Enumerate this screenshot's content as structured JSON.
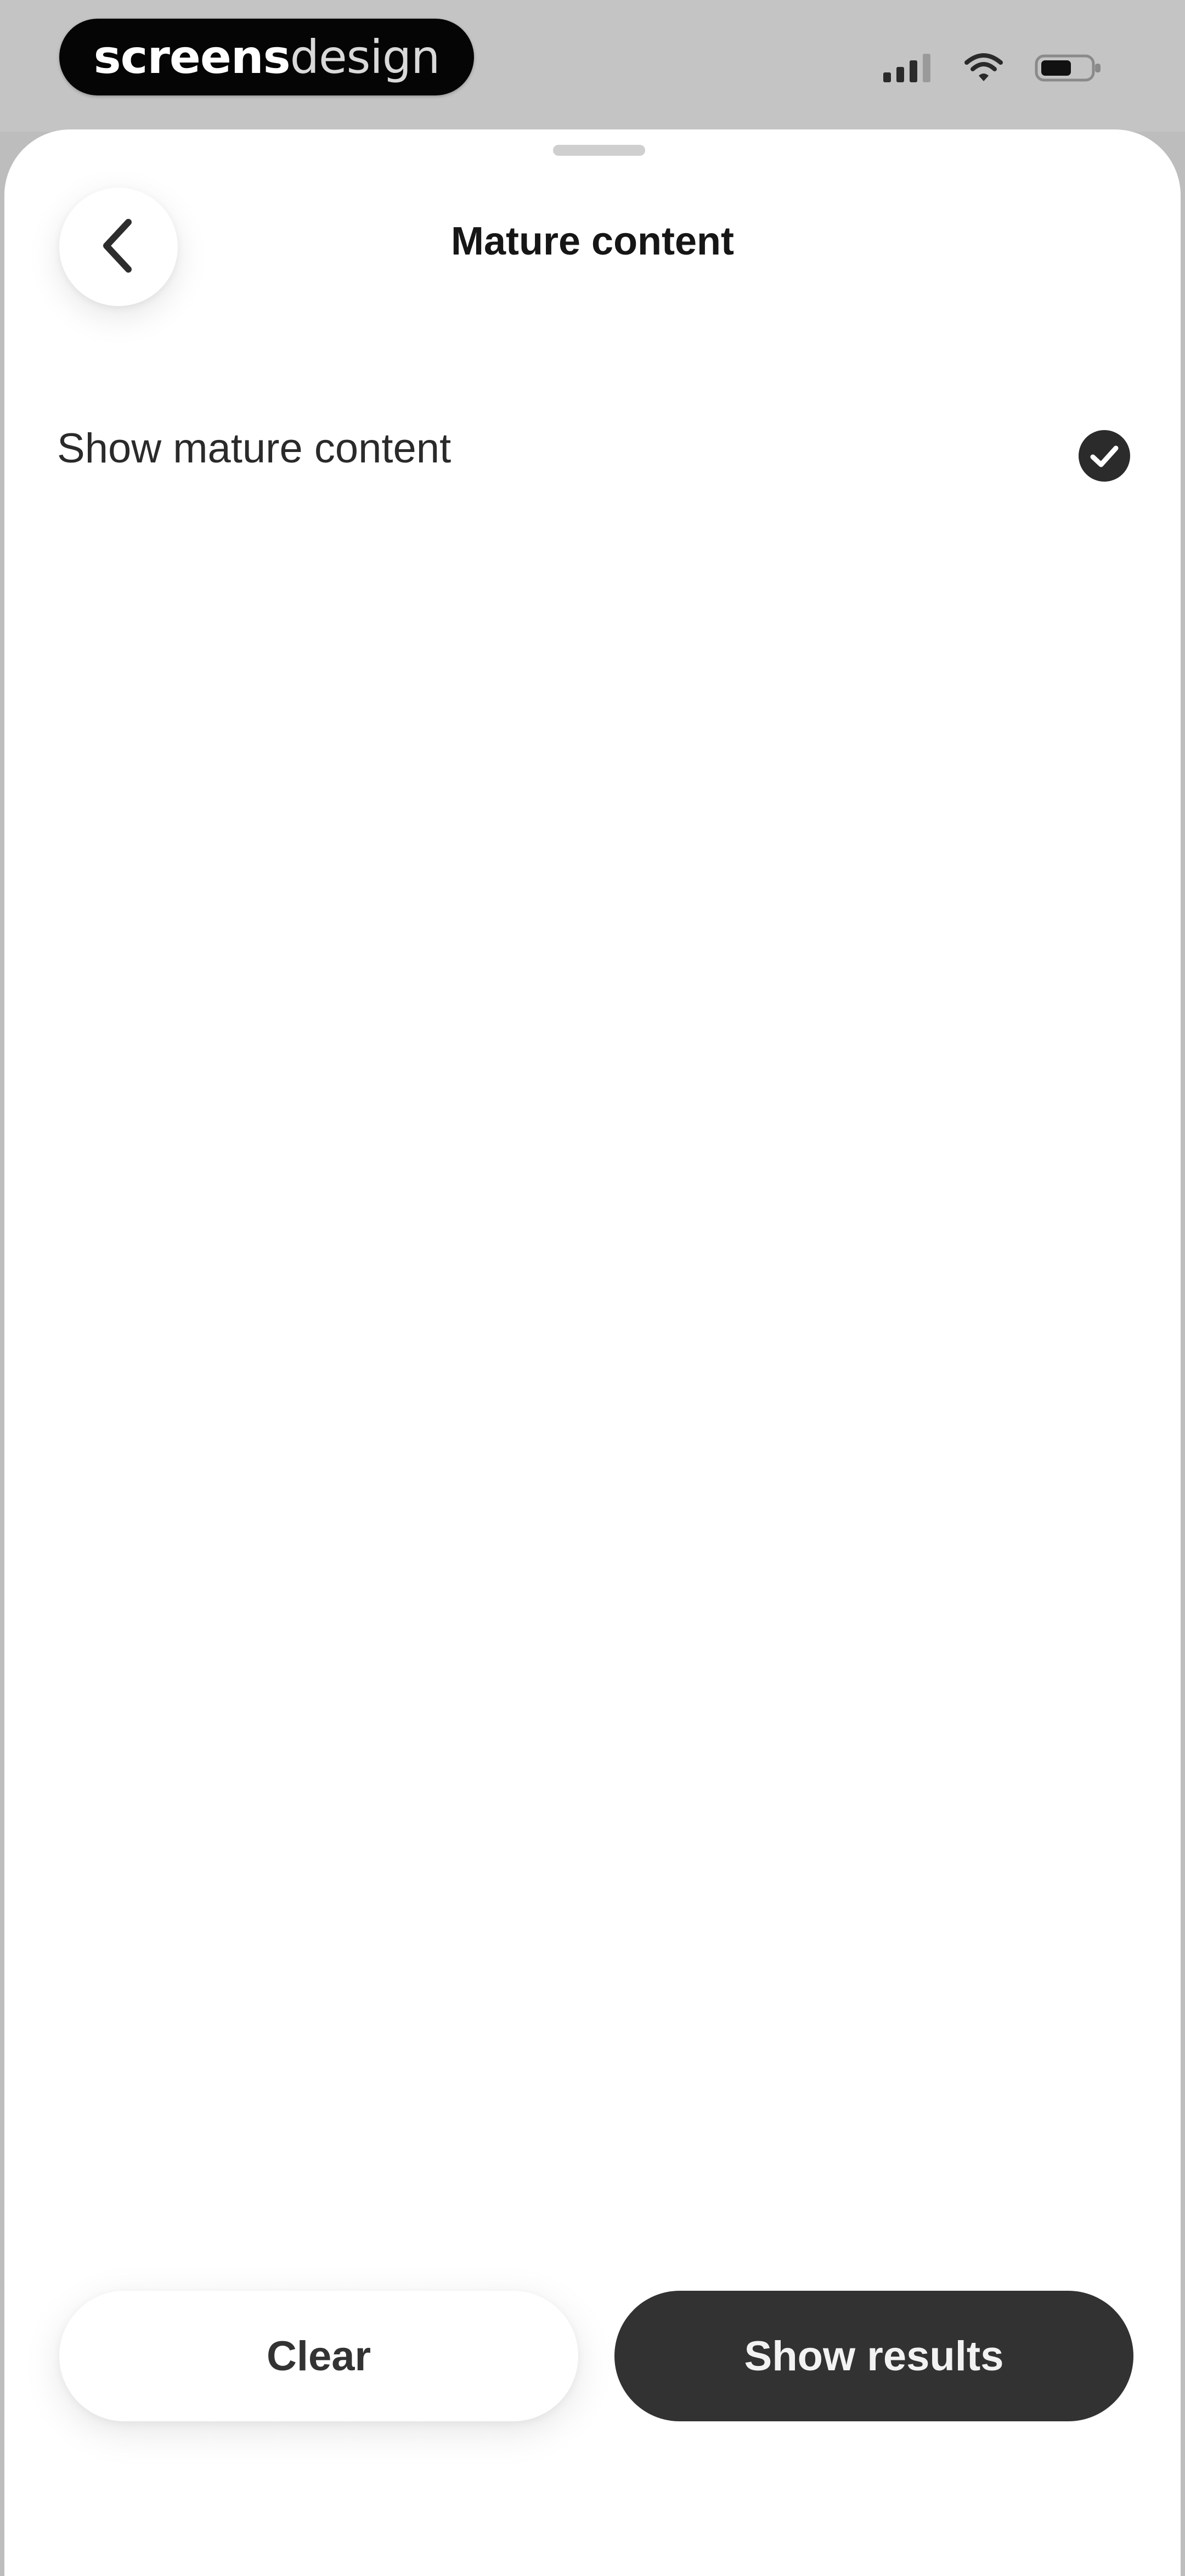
{
  "status_bar": {
    "logo": {
      "bold_part": "screens",
      "light_part": "design"
    },
    "icons": [
      "cellular-signal-icon",
      "wifi-icon",
      "battery-icon"
    ]
  },
  "header": {
    "title": "Mature content",
    "back_icon": "chevron-left-icon"
  },
  "options": [
    {
      "label": "Show mature content",
      "checked": true,
      "check_icon": "check-circle-icon"
    }
  ],
  "footer": {
    "clear_label": "Clear",
    "show_results_label": "Show results"
  },
  "colors": {
    "primary_button": "#323232",
    "check_fill": "#2b2b2b",
    "status_bar_bg": "#c4c4c4"
  }
}
